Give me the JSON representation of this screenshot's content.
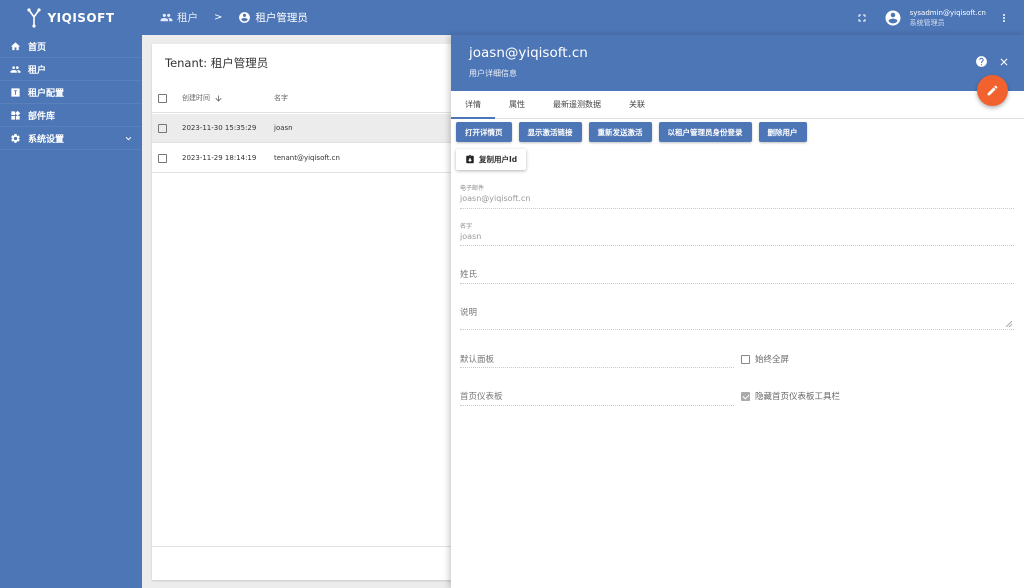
{
  "app": {
    "logo_text": "YIQISOFT"
  },
  "sidebar": {
    "items": [
      {
        "label": "首页",
        "icon": "home-icon"
      },
      {
        "label": "租户",
        "icon": "users-icon"
      },
      {
        "label": "租户配置",
        "icon": "tenant-profile-icon"
      },
      {
        "label": "部件库",
        "icon": "widgets-icon"
      },
      {
        "label": "系统设置",
        "icon": "gear-icon"
      }
    ]
  },
  "header": {
    "breadcrumb": [
      {
        "label": "租户",
        "icon": "users-icon"
      },
      {
        "label": "租户管理员",
        "icon": "account-circle-icon"
      }
    ],
    "breadcrumb_separator": ">",
    "user_email": "sysadmin@yiqisoft.cn",
    "user_role": "系统管理员"
  },
  "table": {
    "title": "Tenant: 租户管理员",
    "columns": {
      "created": "创建时间",
      "name": "名字"
    },
    "rows": [
      {
        "created": "2023-11-30 15:35:29",
        "name": "joasn",
        "selected": true
      },
      {
        "created": "2023-11-29 18:14:19",
        "name": "tenant@yiqisoft.cn",
        "selected": false
      }
    ]
  },
  "detail": {
    "title": "joasn@yiqisoft.cn",
    "subtitle": "用户详细信息",
    "tabs": [
      "详情",
      "属性",
      "最新遥测数据",
      "关联"
    ],
    "actions": [
      "打开详情页",
      "显示激活链接",
      "重新发送激活",
      "以租户管理员身份登录",
      "删除用户"
    ],
    "copy_button": "复制用户Id",
    "fields": {
      "email": {
        "label": "电子邮件",
        "value": "joasn@yiqisoft.cn"
      },
      "name": {
        "label": "名字",
        "value": "joasn"
      },
      "last_name": {
        "placeholder": "姓氏"
      },
      "description": {
        "placeholder": "说明"
      },
      "default_dashboard": {
        "placeholder": "默认面板"
      },
      "home_dashboard": {
        "placeholder": "首页仪表板"
      }
    },
    "checkboxes": {
      "always_fullscreen": {
        "label": "始终全屏",
        "checked": false
      },
      "hide_toolbar": {
        "label": "隐藏首页仪表板工具栏",
        "checked": true
      }
    }
  },
  "colors": {
    "primary": "#4d76b6",
    "accent": "#f2622e"
  }
}
